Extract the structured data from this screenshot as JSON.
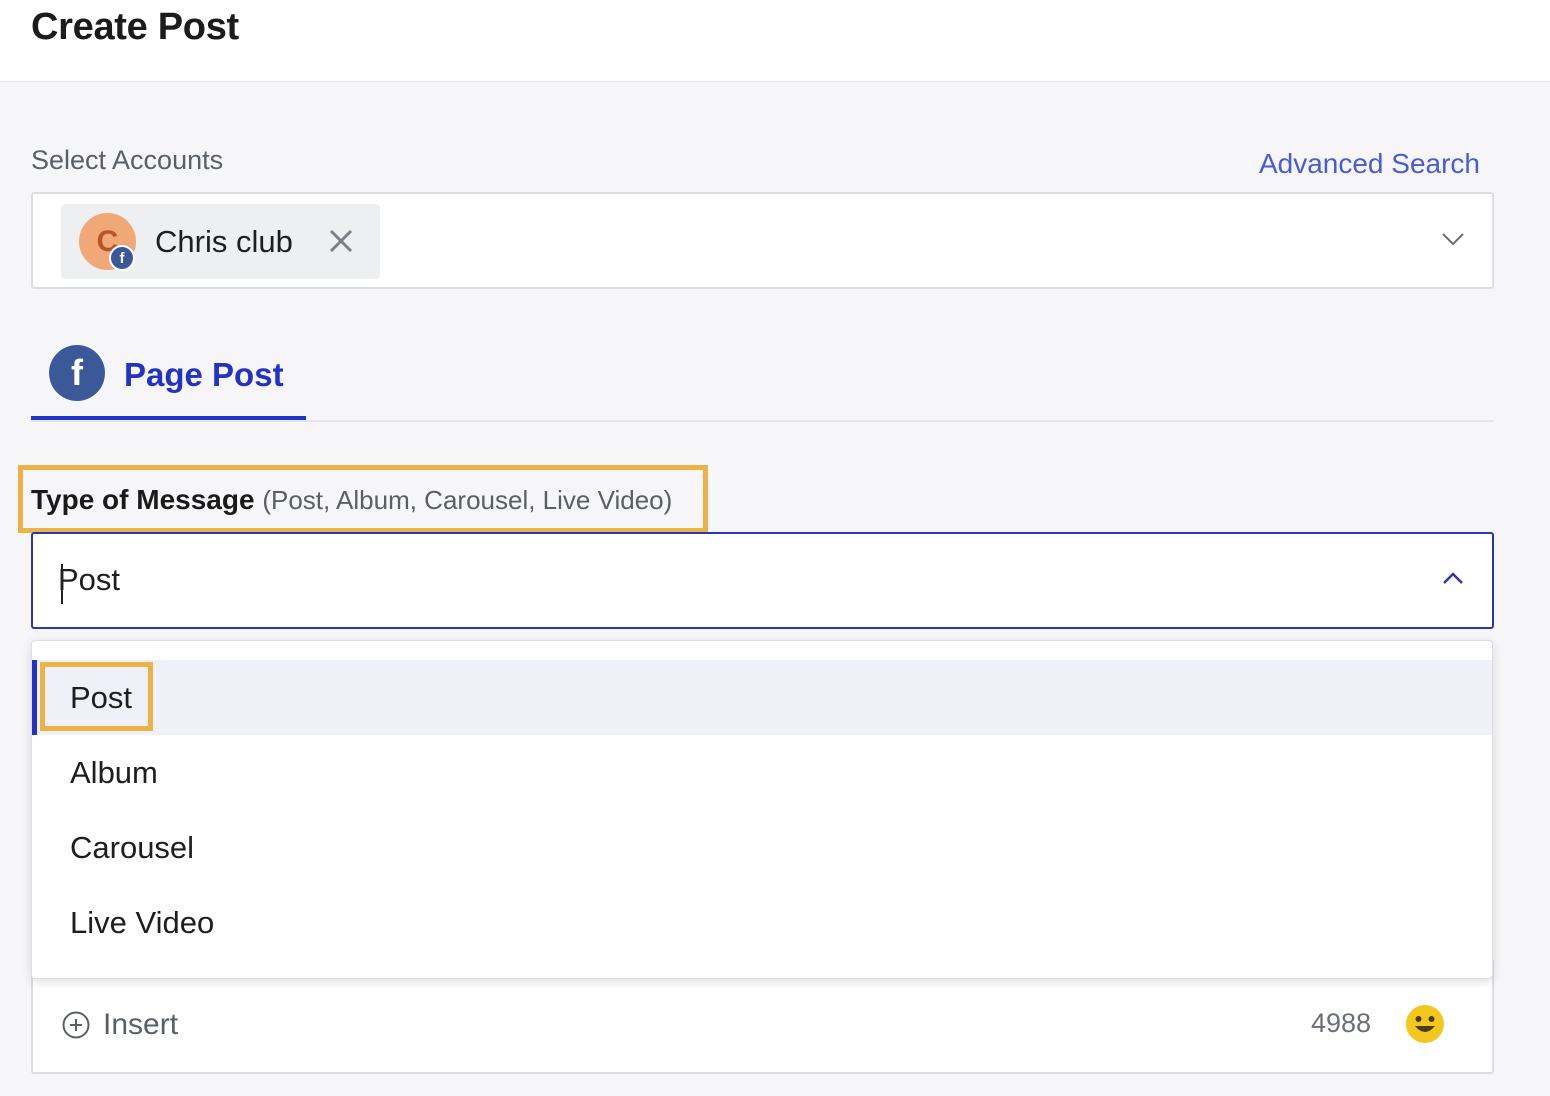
{
  "header": {
    "title": "Create Post"
  },
  "accounts": {
    "label": "Select Accounts",
    "advanced_search": "Advanced Search",
    "selected": [
      {
        "initial": "C",
        "name": "Chris club",
        "network_badge": "f",
        "network_icon": "facebook-icon"
      }
    ],
    "chevron_icon": "chevron-down-icon",
    "remove_icon": "close-icon"
  },
  "tabs": [
    {
      "label": "Page Post",
      "icon": "facebook-icon",
      "icon_glyph": "f",
      "active": true
    }
  ],
  "message_type": {
    "label": "Type of Message",
    "hint": "(Post, Album, Carousel, Live Video)",
    "value": "Post",
    "chevron_icon": "chevron-up-icon",
    "options": [
      {
        "label": "Post",
        "selected": true
      },
      {
        "label": "Album",
        "selected": false
      },
      {
        "label": "Carousel",
        "selected": false
      },
      {
        "label": "Live Video",
        "selected": false
      }
    ]
  },
  "composer": {
    "insert_label": "Insert",
    "insert_icon": "plus-circle-icon",
    "char_count": "4988",
    "emoji_icon": "smiley-icon"
  },
  "colors": {
    "accent": "#2332c6",
    "link": "#4a5bd6",
    "facebook": "#3b5998",
    "highlight": "#ebb245",
    "emoji": "#f2c81f"
  }
}
